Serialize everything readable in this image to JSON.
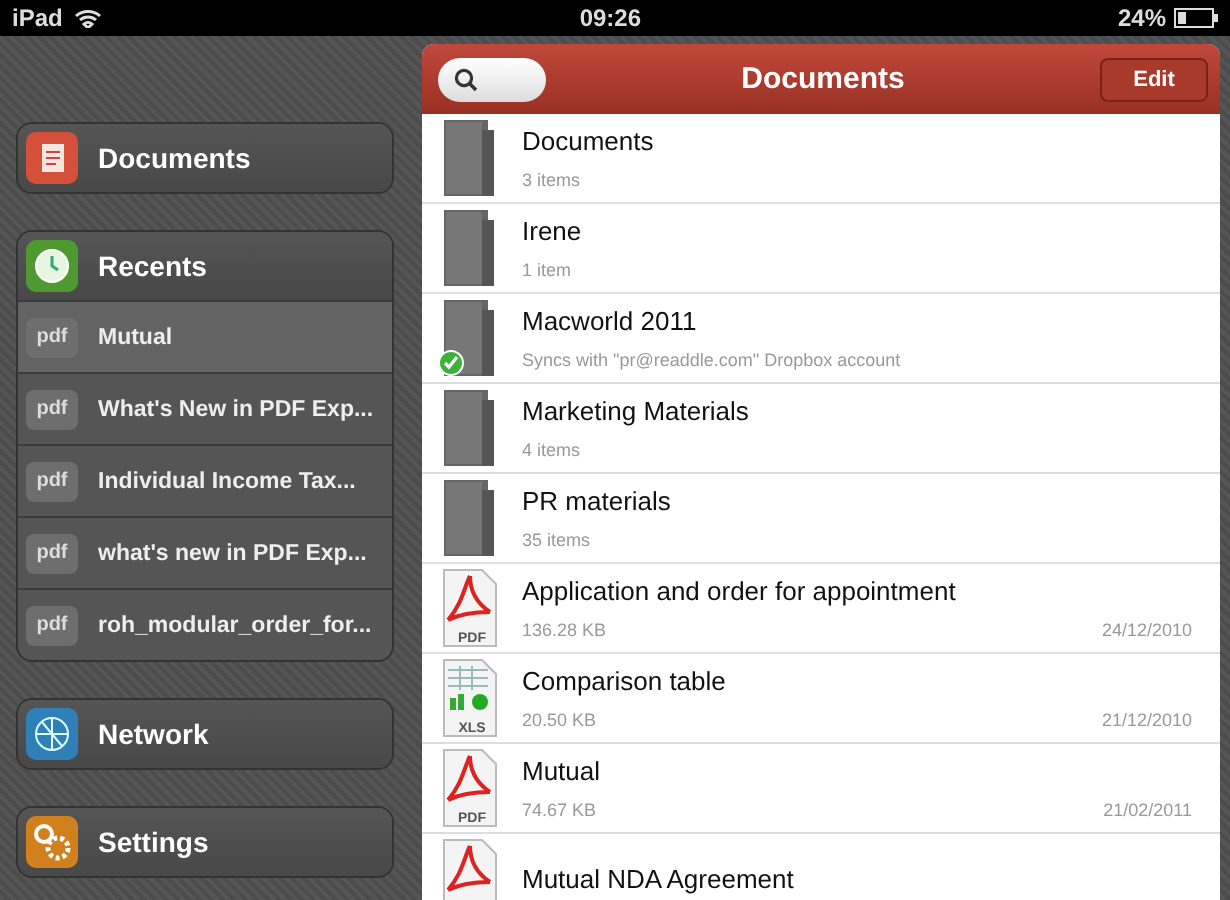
{
  "status_bar": {
    "device": "iPad",
    "time": "09:26",
    "battery": "24%"
  },
  "sidebar": {
    "sections": [
      {
        "kind": "documents",
        "label": "Documents",
        "selected": false
      },
      {
        "kind": "recents",
        "label": "Recents",
        "selected": false,
        "items": [
          {
            "badge": "pdf",
            "label": "Mutual",
            "selected": true
          },
          {
            "badge": "pdf",
            "label": "What's New in PDF Exp...",
            "selected": false
          },
          {
            "badge": "pdf",
            "label": "Individual Income Tax...",
            "selected": false
          },
          {
            "badge": "pdf",
            "label": "what's new in PDF Exp...",
            "selected": false
          },
          {
            "badge": "pdf",
            "label": "roh_modular_order_for...",
            "selected": false
          }
        ]
      },
      {
        "kind": "network",
        "label": "Network",
        "selected": false
      },
      {
        "kind": "settings",
        "label": "Settings",
        "selected": false
      }
    ]
  },
  "panel": {
    "title": "Documents",
    "edit_button": "Edit",
    "rows": [
      {
        "kind": "folder",
        "name": "Documents",
        "detail": "3 items",
        "synced": false
      },
      {
        "kind": "folder",
        "name": "Irene",
        "detail": "1 item",
        "synced": false
      },
      {
        "kind": "folder",
        "name": "Macworld 2011",
        "detail": "Syncs with \"pr@readdle.com\" Dropbox account",
        "synced": true
      },
      {
        "kind": "folder",
        "name": "Marketing Materials",
        "detail": "4 items",
        "synced": false
      },
      {
        "kind": "folder",
        "name": "PR materials",
        "detail": "35 items",
        "synced": false
      },
      {
        "kind": "pdf",
        "badge": "PDF",
        "name": "Application and order for appointment",
        "detail": "136.28 KB",
        "date": "24/12/2010",
        "synced": false
      },
      {
        "kind": "xls",
        "badge": "XLS",
        "name": "Comparison table",
        "detail": "20.50 KB",
        "date": "21/12/2010",
        "synced": false
      },
      {
        "kind": "pdf",
        "badge": "PDF",
        "name": "Mutual",
        "detail": "74.67 KB",
        "date": "21/02/2011",
        "synced": false
      },
      {
        "kind": "pdf",
        "name": "Mutual NDA Agreement",
        "synced": false
      }
    ]
  }
}
